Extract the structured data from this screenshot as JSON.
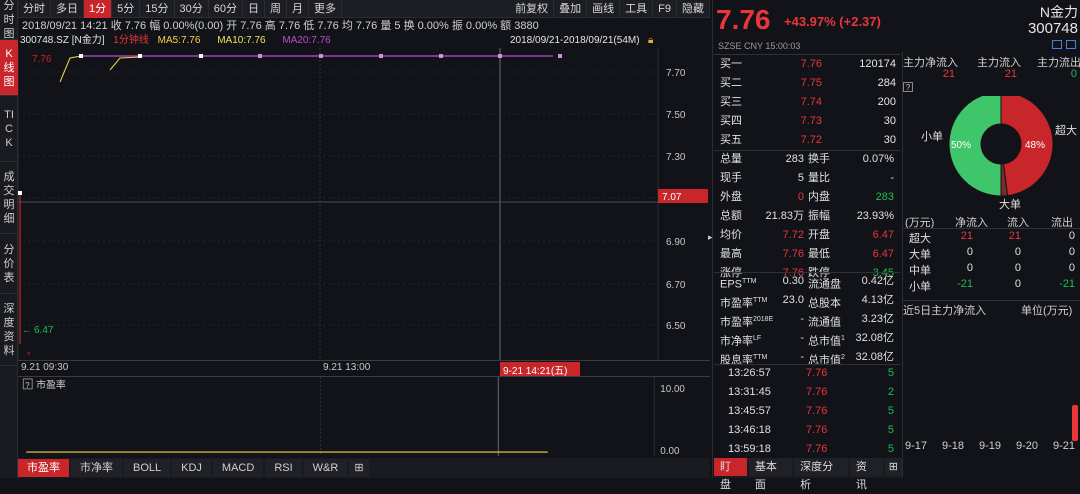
{
  "left_nav": [
    {
      "label": "分时图",
      "active": false
    },
    {
      "label": "K线图",
      "active": true
    },
    {
      "label": "TICK",
      "active": false
    },
    {
      "label": "成交明细",
      "active": false
    },
    {
      "label": "分价表",
      "active": false
    },
    {
      "label": "深度资料",
      "active": false
    }
  ],
  "toolbar": {
    "periods": [
      "分时",
      "多日",
      "1分",
      "5分",
      "15分",
      "30分",
      "60分",
      "日",
      "周",
      "月",
      "更多"
    ],
    "active_period": "1分",
    "right": [
      "前复权",
      "叠加",
      "画线",
      "工具",
      "F9",
      "隐藏"
    ]
  },
  "infobar": "2018/09/21 14:21  收 7.76  幅 0.00%(0.00)  开 7.76  高 7.76  低 7.76  均 7.76  量 5  换 0.00%  振 0.00%  额 3880",
  "ma_bar": {
    "code": "300748.SZ [N金力]",
    "period_label": "1分钟线",
    "ma5": "MA5:7.76",
    "ma10": "MA10:7.76",
    "ma20": "MA20:7.76",
    "range": "2018/09/21-2018/09/21(54M)",
    "lock_icon": "lock-icon"
  },
  "chart": {
    "y_ticks": [
      "7.70",
      "7.50",
      "7.30",
      "7.10",
      "6.90",
      "6.70",
      "6.50"
    ],
    "current_label": "7.07",
    "hi_label": "7.76",
    "lo_label": "6.47",
    "x_labels": [
      "9.21 09:30",
      "9.21 13:00",
      "9-21 14:21(五)"
    ],
    "sub_title": "市盈率",
    "sub_ticks": [
      "10.00",
      "0.00"
    ]
  },
  "bottom_tabs": [
    "市盈率",
    "市净率",
    "BOLL",
    "KDJ",
    "MACD",
    "RSI",
    "W&R"
  ],
  "bottom_active": "市盈率",
  "quote": {
    "price": "7.76",
    "change": "+43.97% (+2.37)",
    "name": "N金力",
    "code": "300748",
    "exchange": "SZSE  CNY   15:00:03",
    "bids": [
      {
        "label": "买一",
        "price": "7.76",
        "vol": "120174"
      },
      {
        "label": "买二",
        "price": "7.75",
        "vol": "284"
      },
      {
        "label": "买三",
        "price": "7.74",
        "vol": "200"
      },
      {
        "label": "买四",
        "price": "7.73",
        "vol": "30"
      },
      {
        "label": "买五",
        "price": "7.72",
        "vol": "30"
      }
    ],
    "stats": [
      {
        "l1": "总量",
        "v1": "283",
        "l2": "换手",
        "v2": "0.07%",
        "c1": "white",
        "c2": "white"
      },
      {
        "l1": "现手",
        "v1": "5",
        "l2": "量比",
        "v2": "-",
        "c1": "white",
        "c2": "white"
      },
      {
        "l1": "外盘",
        "v1": "0",
        "l2": "内盘",
        "v2": "283",
        "c1": "red",
        "c2": "green"
      },
      {
        "l1": "总额",
        "v1": "21.83万",
        "l2": "振幅",
        "v2": "23.93%",
        "c1": "white",
        "c2": "white"
      },
      {
        "l1": "均价",
        "v1": "7.72",
        "l2": "开盘",
        "v2": "6.47",
        "c1": "red",
        "c2": "red"
      },
      {
        "l1": "最高",
        "v1": "7.76",
        "l2": "最低",
        "v2": "6.47",
        "c1": "red",
        "c2": "red"
      },
      {
        "l1": "涨停",
        "v1": "7.76",
        "l2": "跌停",
        "v2": "3.45",
        "c1": "red",
        "c2": "green"
      }
    ],
    "fund": [
      {
        "l1": "EPS",
        "s1": "TTM",
        "v1": "0.30",
        "l2": "流通盘",
        "s2": "",
        "v2": "0.42亿"
      },
      {
        "l1": "市盈率",
        "s1": "TTM",
        "v1": "23.0",
        "l2": "总股本",
        "s2": "",
        "v2": "4.13亿"
      },
      {
        "l1": "市盈率",
        "s1": "2018E",
        "v1": "-",
        "l2": "流通值",
        "s2": "",
        "v2": "3.23亿"
      },
      {
        "l1": "市净率",
        "s1": "LF",
        "v1": "-",
        "l2": "总市值",
        "s2": "1",
        "v2": "32.08亿"
      },
      {
        "l1": "股息率",
        "s1": "TTM",
        "v1": "-",
        "l2": "总市值",
        "s2": "2",
        "v2": "32.08亿"
      }
    ],
    "ticks": [
      {
        "t": "13:26:57",
        "p": "7.76",
        "v": "5"
      },
      {
        "t": "13:31:45",
        "p": "7.76",
        "v": "2"
      },
      {
        "t": "13:45:57",
        "p": "7.76",
        "v": "5"
      },
      {
        "t": "13:46:18",
        "p": "7.76",
        "v": "5"
      },
      {
        "t": "13:59:18",
        "p": "7.76",
        "v": "5"
      }
    ],
    "tabs": [
      "盯盘",
      "基本面",
      "深度分析",
      "资讯"
    ],
    "tab_active": "盯盘"
  },
  "capital": {
    "headers": [
      "主力净流入",
      "主力流入",
      "主力流出"
    ],
    "values": [
      "21",
      "21",
      "0"
    ],
    "pie_labels": {
      "small": "小单",
      "big": "超大",
      "large": "大单"
    },
    "small_pct": 50,
    "super_pct": 48,
    "small_text": "50%",
    "super_text": "48%",
    "table_headers": [
      "(万元)",
      "净流入",
      "流入",
      "流出"
    ],
    "table_rows": [
      {
        "label": "超大",
        "net": "21",
        "in": "21",
        "out": "0"
      },
      {
        "label": "大单",
        "net": "0",
        "in": "0",
        "out": "0"
      },
      {
        "label": "中单",
        "net": "0",
        "in": "0",
        "out": "0"
      },
      {
        "label": "小单",
        "net": "-21",
        "in": "0",
        "out": "-21"
      }
    ],
    "five_day_title": "近5日主力净流入",
    "unit": "单位(万元)",
    "days": [
      "9-17",
      "9-18",
      "9-19",
      "9-20",
      "9-21"
    ],
    "colors": {
      "red": "#c8262b",
      "green": "#3fc56a"
    }
  }
}
